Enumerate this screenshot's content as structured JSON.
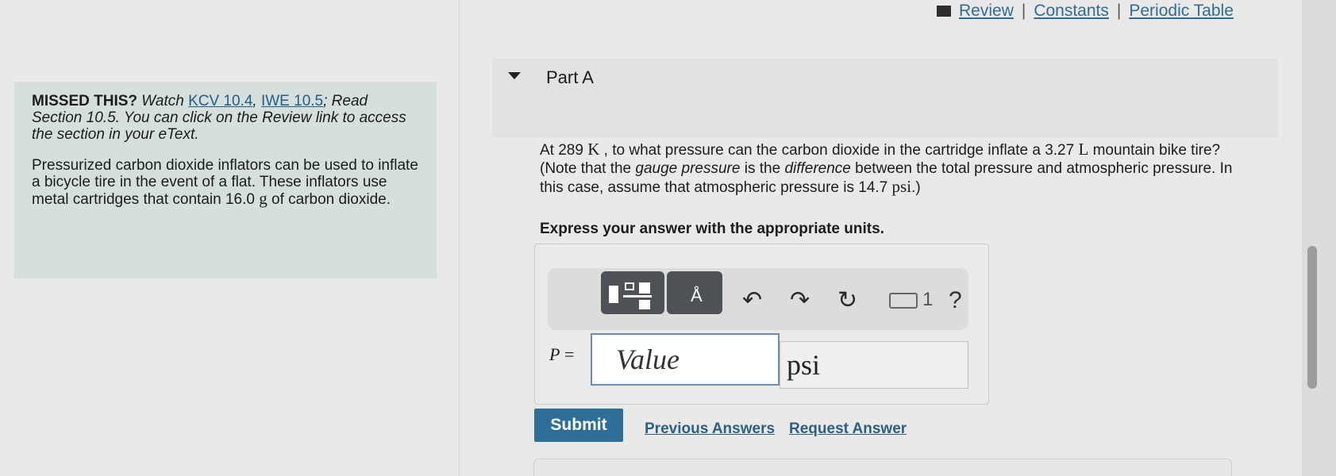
{
  "top_links": {
    "review": "Review",
    "constants": "Constants",
    "periodic_table": "Periodic Table",
    "separator": "|"
  },
  "intro": {
    "missed_label": "MISSED THIS?",
    "watch_text": " Watch ",
    "kcv_link": "KCV 10.4",
    "comma": ", ",
    "iwe_link": "IWE 10.5",
    "read_text": "; Read Section 10.5. You can click on the Review link to access the section in your eText.",
    "para2_a": "Pressurized carbon dioxide inflators can be used to inflate a bicycle tire in the event of a flat. These inflators use metal cartridges that contain 16.0 ",
    "para2_unit": "g",
    "para2_b": " of carbon dioxide."
  },
  "part": {
    "label": "Part A"
  },
  "question": {
    "t1": "At 289 ",
    "u1": "K",
    "t2": " , to what pressure can the carbon dioxide in the cartridge inflate a 3.27 ",
    "u2": "L",
    "t3": "  mountain bike tire? (Note that the ",
    "em1": "gauge pressure",
    "t4": " is the ",
    "em2": "difference",
    "t5": " between the total pressure and atmospheric pressure. In this case, assume that atmospheric pressure is 14.7 ",
    "u3": "psi",
    "t6": ".)",
    "express": "Express your answer with the appropriate units."
  },
  "answer": {
    "variable": "P",
    "equals": " =",
    "value_placeholder": "Value",
    "units_value": "psi"
  },
  "toolbar": {
    "keyboard_count": "1",
    "help": "?"
  },
  "actions": {
    "submit": "Submit",
    "previous_answers": "Previous Answers",
    "request_answer": "Request Answer"
  }
}
